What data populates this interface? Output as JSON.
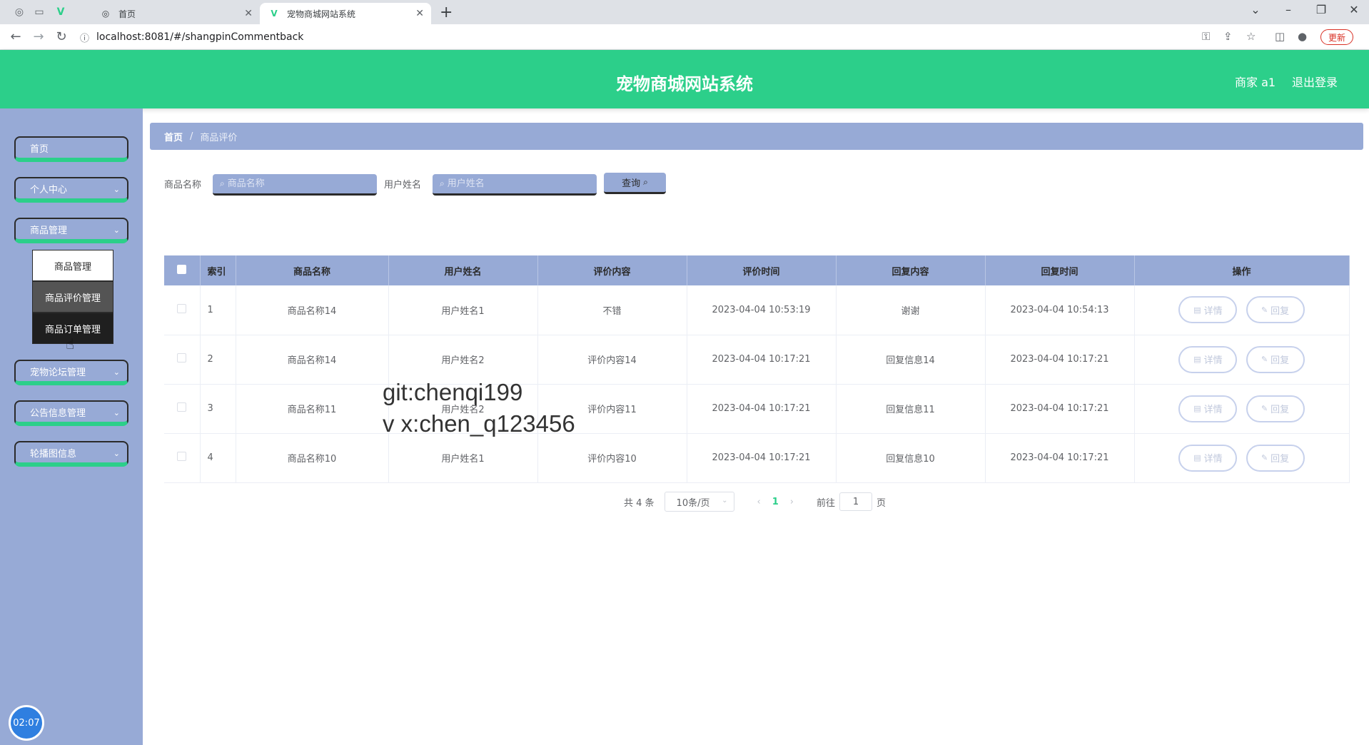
{
  "browser": {
    "tabs": [
      {
        "label": "首页"
      },
      {
        "label": "宠物商城网站系统"
      }
    ],
    "url": "localhost:8081/#/shangpinCommentback",
    "update_label": "更新"
  },
  "header": {
    "title": "宠物商城网站系统",
    "user": "商家 a1",
    "logout": "退出登录"
  },
  "sidebar": {
    "items": [
      {
        "label": "首页"
      },
      {
        "label": "个人中心"
      },
      {
        "label": "商品管理"
      },
      {
        "label": "宠物论坛管理"
      },
      {
        "label": "公告信息管理"
      },
      {
        "label": "轮播图信息"
      }
    ],
    "submenu": [
      {
        "label": "商品管理"
      },
      {
        "label": "商品评价管理"
      },
      {
        "label": "商品订单管理"
      }
    ],
    "timer": "02:07"
  },
  "breadcrumb": {
    "home": "首页",
    "separator": "/",
    "current": "商品评价"
  },
  "search": {
    "product_label": "商品名称",
    "product_placeholder": "商品名称",
    "user_label": "用户姓名",
    "user_placeholder": "用户姓名",
    "query_label": "查询"
  },
  "table": {
    "headers": [
      "索引",
      "商品名称",
      "用户姓名",
      "评价内容",
      "评价时间",
      "回复内容",
      "回复时间",
      "操作"
    ],
    "rows": [
      {
        "index": "1",
        "product": "商品名称14",
        "user": "用户姓名1",
        "content": "不错",
        "time": "2023-04-04 10:53:19",
        "reply": "谢谢",
        "reply_time": "2023-04-04 10:54:13"
      },
      {
        "index": "2",
        "product": "商品名称14",
        "user": "用户姓名2",
        "content": "评价内容14",
        "time": "2023-04-04 10:17:21",
        "reply": "回复信息14",
        "reply_time": "2023-04-04 10:17:21"
      },
      {
        "index": "3",
        "product": "商品名称11",
        "user": "用户姓名2",
        "content": "评价内容11",
        "time": "2023-04-04 10:17:21",
        "reply": "回复信息11",
        "reply_time": "2023-04-04 10:17:21"
      },
      {
        "index": "4",
        "product": "商品名称10",
        "user": "用户姓名1",
        "content": "评价内容10",
        "time": "2023-04-04 10:17:21",
        "reply": "回复信息10",
        "reply_time": "2023-04-04 10:17:21"
      }
    ],
    "detail_label": "详情",
    "reply_label": "回复"
  },
  "watermark": {
    "line1": "git:chenqi199",
    "line2": "v x:chen_q123456"
  },
  "pagination": {
    "total": "共 4 条",
    "page_size": "10条/页",
    "current_page": "1",
    "goto_label": "前往",
    "goto_value": "1",
    "page_suffix": "页"
  },
  "colors": {
    "header": "#2ccf8a",
    "sidebar": "#97aad6",
    "accent": "#2ccf8a"
  }
}
